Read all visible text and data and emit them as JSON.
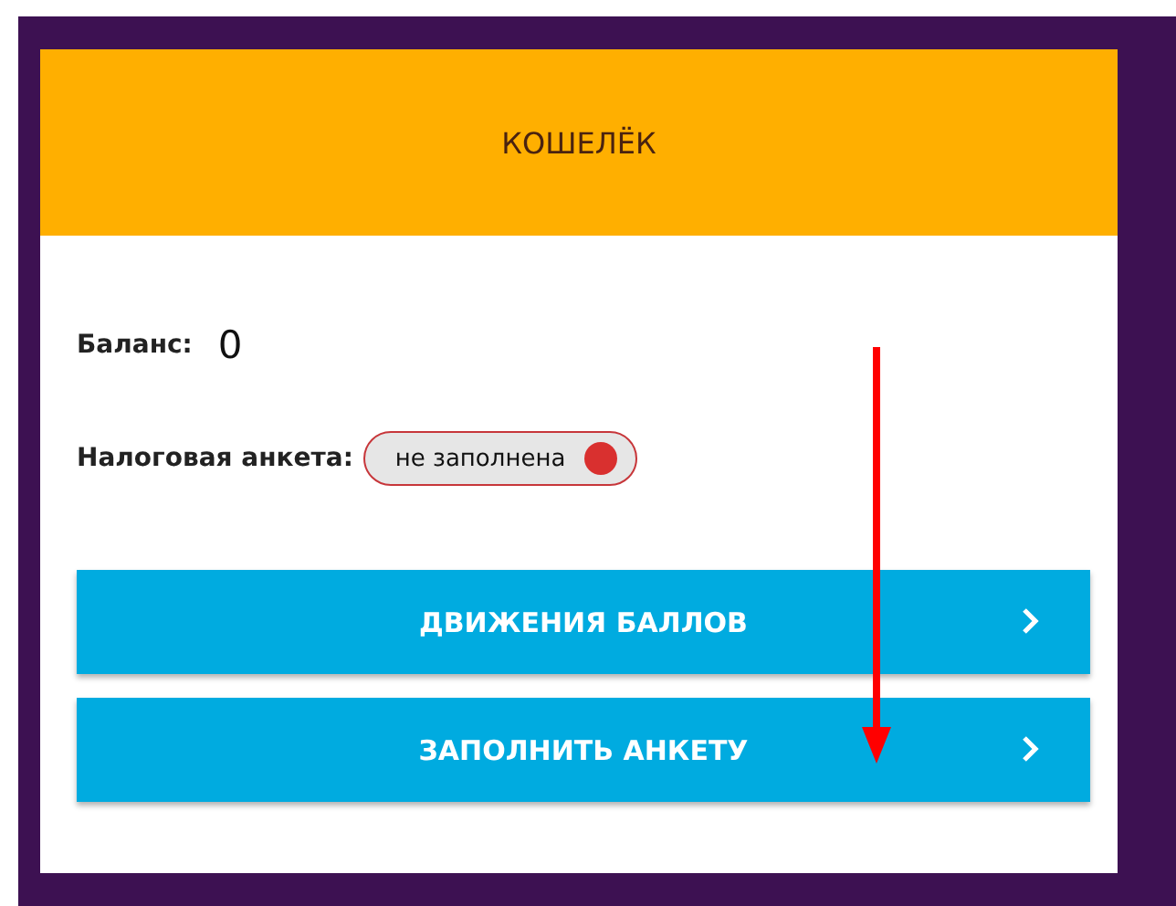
{
  "header": {
    "title": "КОШЕЛЁК"
  },
  "balance": {
    "label": "Баланс:",
    "value": "0"
  },
  "tax_form": {
    "label": "Налоговая анкета:",
    "status": "не заполнена",
    "filled": false
  },
  "buttons": [
    {
      "label": "ДВИЖЕНИЯ БАЛЛОВ"
    },
    {
      "label": "ЗАПОЛНИТЬ АНКЕТУ"
    }
  ]
}
